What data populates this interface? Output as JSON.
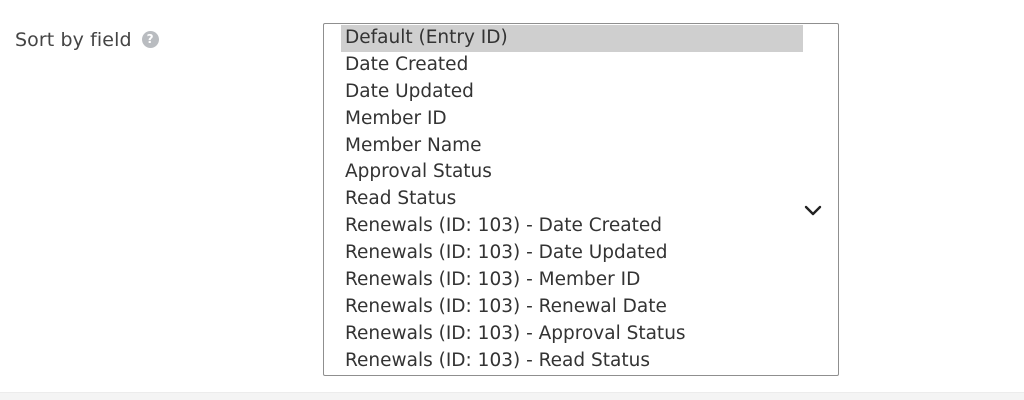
{
  "field": {
    "label": "Sort by field",
    "help_icon": "help-question-icon"
  },
  "select": {
    "selected": "Default (Entry ID)",
    "dropdown_icon": "chevron-down-icon",
    "options": [
      "Default (Entry ID)",
      "Date Created",
      "Date Updated",
      "Member ID",
      "Member Name",
      "Approval Status",
      "Read Status",
      "Renewals (ID: 103) - Date Created",
      "Renewals (ID: 103) - Date Updated",
      "Renewals (ID: 103) - Member ID",
      "Renewals (ID: 103) - Renewal Date",
      "Renewals (ID: 103) - Approval Status",
      "Renewals (ID: 103) - Read Status"
    ]
  },
  "colors": {
    "label_text": "#444444",
    "help_icon_bg": "#b9bcc0",
    "selected_option_bg": "#cfcfcf",
    "option_text": "#333333",
    "select_border": "#8f8f8f"
  }
}
